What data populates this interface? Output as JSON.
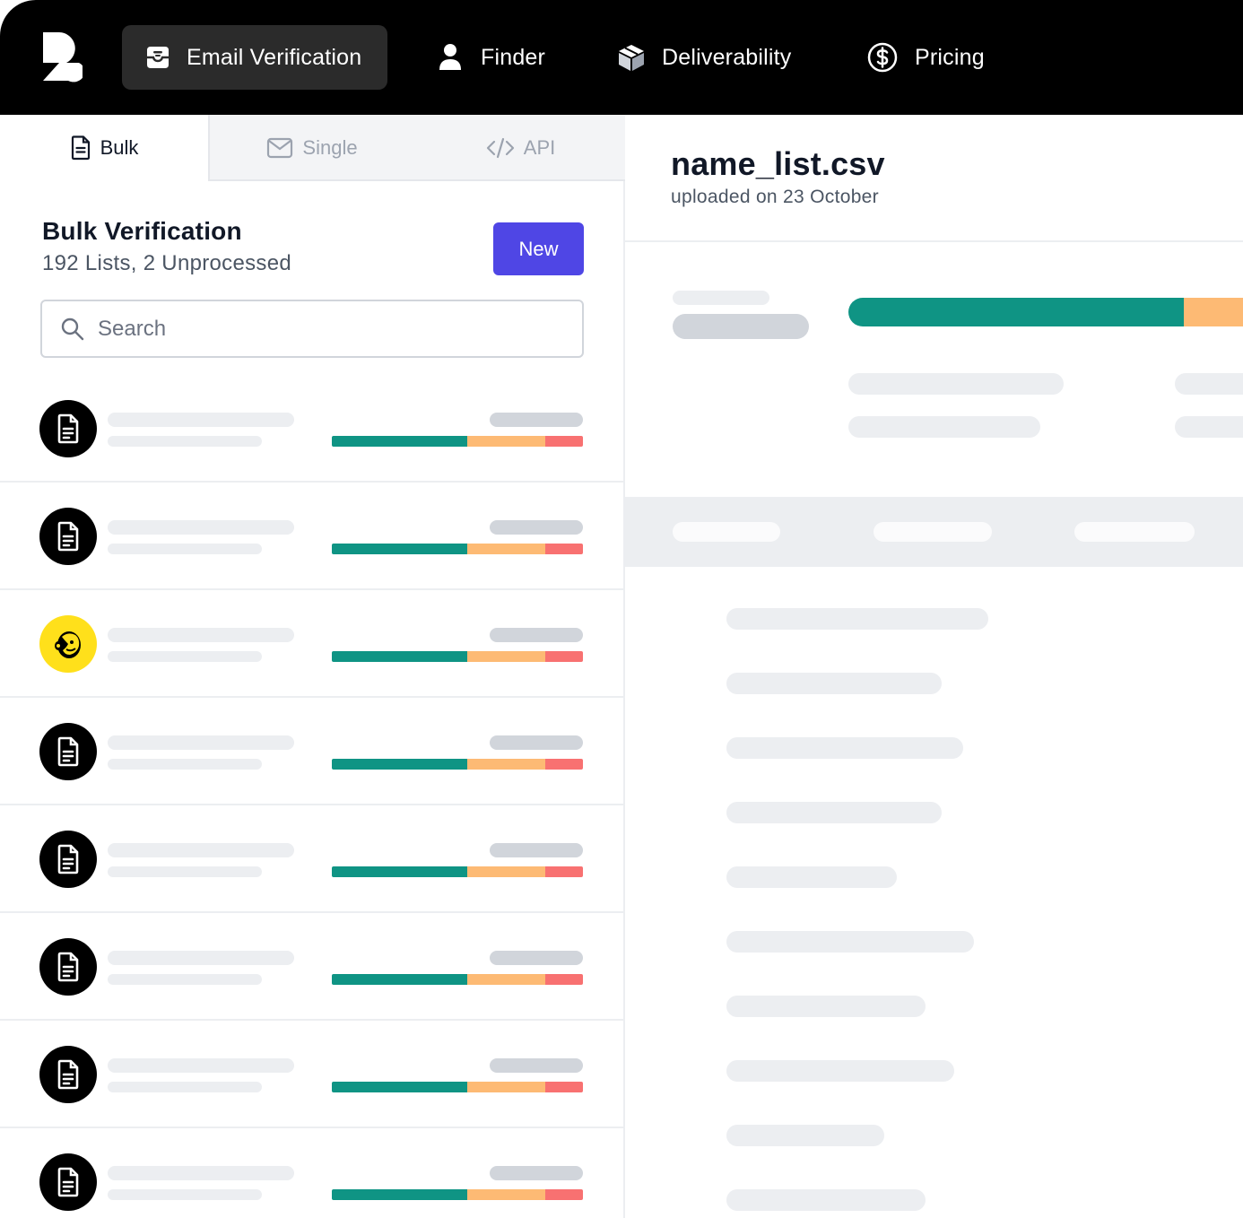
{
  "nav": {
    "items": [
      {
        "label": "Email Verification",
        "icon": "inbox-icon",
        "active": true
      },
      {
        "label": "Finder",
        "icon": "user-icon",
        "active": false
      },
      {
        "label": "Deliverability",
        "icon": "box-icon",
        "active": false
      },
      {
        "label": "Pricing",
        "icon": "dollar-circle-icon",
        "active": false
      }
    ]
  },
  "tabs": [
    {
      "label": "Bulk",
      "icon": "document-icon",
      "active": true
    },
    {
      "label": "Single",
      "icon": "mail-icon",
      "active": false
    },
    {
      "label": "API",
      "icon": "code-icon",
      "active": false
    }
  ],
  "bulk": {
    "title": "Bulk Verification",
    "subtitle": "192 Lists, 2 Unprocessed",
    "new_label": "New",
    "search_placeholder": "Search"
  },
  "lists": [
    {
      "icon": "document-icon",
      "valid": 0.54,
      "risky": 0.31,
      "invalid": 0.15
    },
    {
      "icon": "document-icon",
      "valid": 0.54,
      "risky": 0.31,
      "invalid": 0.15
    },
    {
      "icon": "mailchimp-icon",
      "valid": 0.54,
      "risky": 0.31,
      "invalid": 0.15
    },
    {
      "icon": "document-icon",
      "valid": 0.54,
      "risky": 0.31,
      "invalid": 0.15
    },
    {
      "icon": "document-icon",
      "valid": 0.54,
      "risky": 0.31,
      "invalid": 0.15
    },
    {
      "icon": "document-icon",
      "valid": 0.54,
      "risky": 0.31,
      "invalid": 0.15
    },
    {
      "icon": "document-icon",
      "valid": 0.54,
      "risky": 0.31,
      "invalid": 0.15
    },
    {
      "icon": "document-icon",
      "valid": 0.54,
      "risky": 0.31,
      "invalid": 0.15
    }
  ],
  "detail": {
    "file_name": "name_list.csv",
    "uploaded": "uploaded on 23 October",
    "summary": {
      "valid": 0.85,
      "risky": 0.15
    }
  },
  "colors": {
    "valid": "#0f9484",
    "risky": "#fdba74",
    "invalid": "#f87171",
    "accent": "#4f46e5"
  }
}
